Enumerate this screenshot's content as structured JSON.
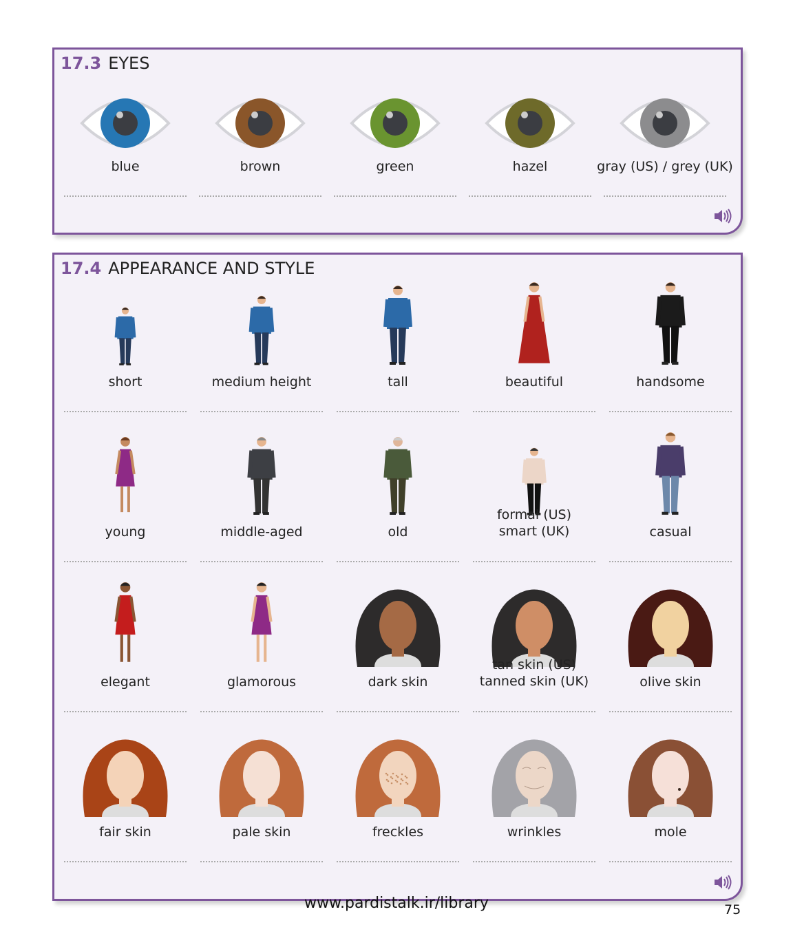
{
  "sections": [
    {
      "number": "17.3",
      "title": "EYES",
      "audio_icon": "speaker-icon",
      "items": [
        {
          "label": "blue",
          "iris": "#2677b4"
        },
        {
          "label": "brown",
          "iris": "#8a562a"
        },
        {
          "label": "green",
          "iris": "#6a9430"
        },
        {
          "label": "hazel",
          "iris": "#6e6a2a"
        },
        {
          "label": "gray (US) / grey (UK)",
          "iris": "#8c8c8e"
        }
      ]
    },
    {
      "number": "17.4",
      "title": "APPEARANCE AND STYLE",
      "audio_icon": "speaker-icon",
      "items": [
        {
          "label": "short"
        },
        {
          "label": "medium height"
        },
        {
          "label": "tall"
        },
        {
          "label": "beautiful"
        },
        {
          "label": "handsome"
        },
        {
          "label": "young"
        },
        {
          "label": "middle-aged"
        },
        {
          "label": "old"
        },
        {
          "label": "formal (US)\nsmart (UK)"
        },
        {
          "label": "casual"
        },
        {
          "label": "elegant"
        },
        {
          "label": "glamorous"
        },
        {
          "label": "dark skin"
        },
        {
          "label": "tan skin (US)\ntanned skin (UK)"
        },
        {
          "label": "olive skin"
        },
        {
          "label": "fair skin"
        },
        {
          "label": "pale skin"
        },
        {
          "label": "freckles"
        },
        {
          "label": "wrinkles"
        },
        {
          "label": "mole"
        }
      ]
    }
  ],
  "footer": {
    "url": "www.pardistalk.ir/library",
    "page_number": "75"
  },
  "colors": {
    "accent": "#7d559b",
    "panel_bg": "#f4f1f8"
  }
}
